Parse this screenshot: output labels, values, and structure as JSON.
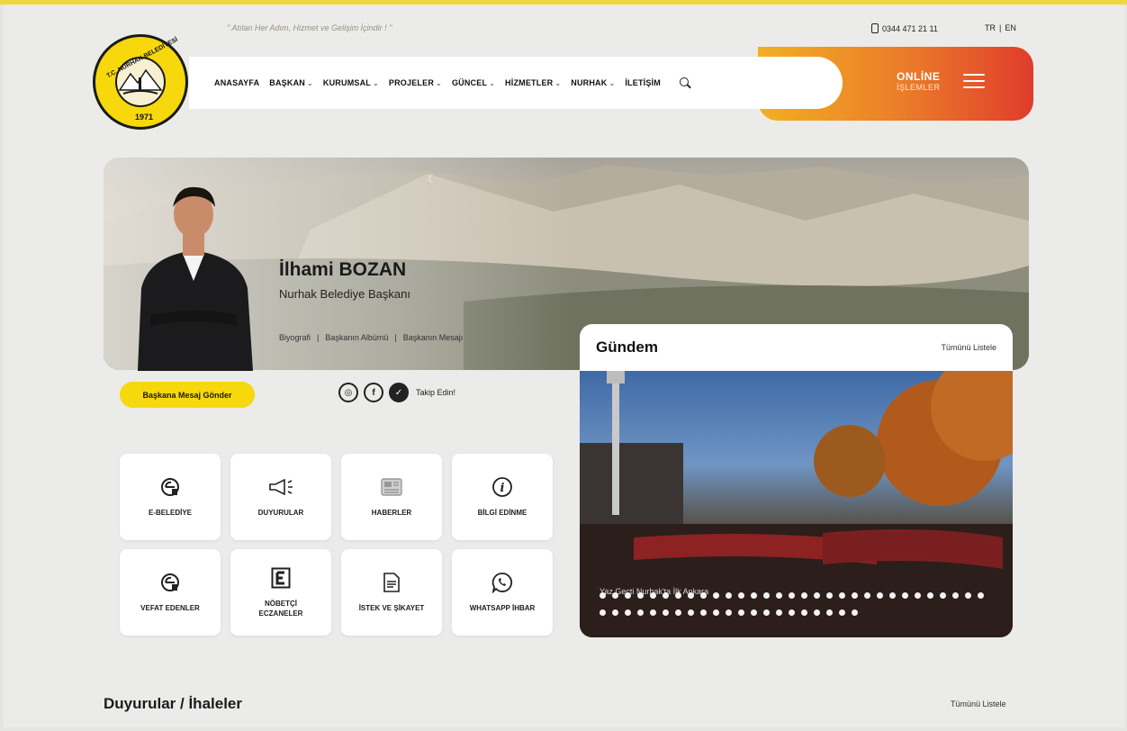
{
  "header": {
    "slogan": "\" Atılan Her Adım, Hizmet ve Gelişim İçindir ! \"",
    "phone": "0344 471 21 11",
    "languages": [
      "TR",
      "EN"
    ],
    "logo": {
      "arc_text": "T.C. NURHAK BELEDİYESİ",
      "year": "1971"
    }
  },
  "nav": {
    "items": [
      {
        "label": "ANASAYFA",
        "dropdown": false
      },
      {
        "label": "BAŞKAN",
        "dropdown": true
      },
      {
        "label": "KURUMSAL",
        "dropdown": true
      },
      {
        "label": "PROJELER",
        "dropdown": true
      },
      {
        "label": "GÜNCEL",
        "dropdown": true
      },
      {
        "label": "HİZMETLER",
        "dropdown": true
      },
      {
        "label": "NURHAK",
        "dropdown": true
      },
      {
        "label": "İLETİŞİM",
        "dropdown": false
      }
    ],
    "search_icon": "search-icon"
  },
  "online": {
    "title": "ONLİNE",
    "subtitle": "İŞLEMLER",
    "icon": "menu-icon"
  },
  "mayor": {
    "name": "İlhami BOZAN",
    "title": "Nurhak Belediye Başkanı",
    "links": [
      "Biyografi",
      "Başkanın Albümü",
      "Başkanın Mesajı"
    ],
    "message_button": "Başkana Mesaj Gönder",
    "follow_text": "Takip Edin!",
    "social_icons": [
      "instagram-icon",
      "facebook-icon",
      "twitter-icon"
    ]
  },
  "tiles": [
    {
      "label": "E-BELEDİYE",
      "icon": "e-belediye-icon"
    },
    {
      "label": "DUYURULAR",
      "icon": "megaphone-icon"
    },
    {
      "label": "HABERLER",
      "icon": "newspaper-icon"
    },
    {
      "label": "BİLGİ EDİNME",
      "icon": "info-icon"
    },
    {
      "label": "VEFAT EDENLER",
      "icon": "e-belediye-icon"
    },
    {
      "label": "NÖBETÇİ ECZANELER",
      "icon": "pharmacy-e-icon"
    },
    {
      "label": "İSTEK VE ŞİKAYET",
      "icon": "document-icon"
    },
    {
      "label": "WHATSAPP İHBAR",
      "icon": "whatsapp-icon"
    }
  ],
  "gundem": {
    "title": "Gündem",
    "list_all": "Tümünü Listele",
    "caption": "Yaz Geçti Nurhak'ta İlk Ankara"
  },
  "announcements": {
    "title": "Duyurular / İhaleler",
    "list_all": "Tümünü Listele"
  },
  "colors": {
    "accent_yellow": "#f6d80c",
    "online_gradient_start": "#f2b021",
    "online_gradient_end": "#e03c2c",
    "page_bg": "#ebebe9"
  }
}
